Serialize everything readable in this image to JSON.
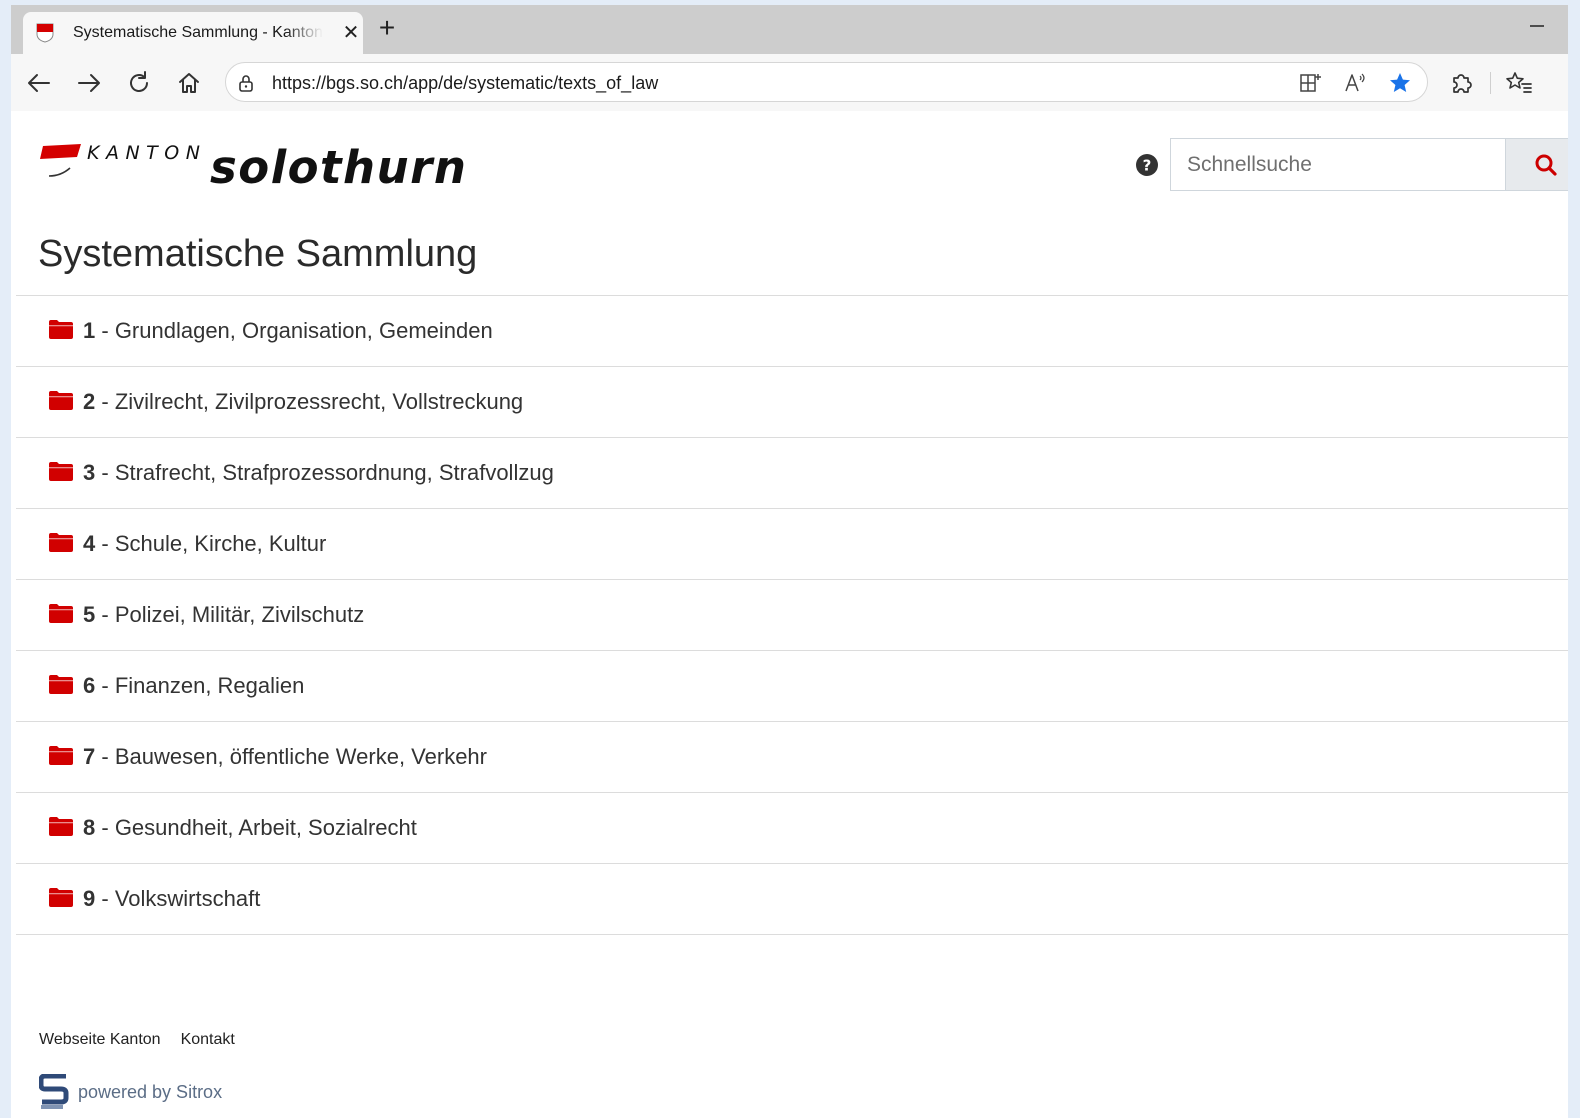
{
  "browser": {
    "tab": {
      "title": "Systematische Sammlung - Kanton Solothurn",
      "close_glyph": "✕"
    },
    "new_tab_glyph": "+",
    "url": "https://bgs.so.ch/app/de/systematic/texts_of_law",
    "favorite_color": "#1a73e8"
  },
  "header": {
    "logo": {
      "word1": "KANTON",
      "word2": "solothurn",
      "accent_color": "#d40000"
    },
    "search_placeholder": "Schnellsuche",
    "search_icon_color": "#cc0000"
  },
  "main": {
    "title": "Systematische Sammlung",
    "folder_color": "#d10000",
    "items": [
      {
        "number": "1",
        "separator": " - ",
        "label": "Grundlagen, Organisation, Gemeinden"
      },
      {
        "number": "2",
        "separator": " - ",
        "label": "Zivilrecht, Zivilprozessrecht, Vollstreckung"
      },
      {
        "number": "3",
        "separator": " - ",
        "label": "Strafrecht, Strafprozessordnung, Strafvollzug"
      },
      {
        "number": "4",
        "separator": " - ",
        "label": "Schule, Kirche, Kultur"
      },
      {
        "number": "5",
        "separator": " - ",
        "label": "Polizei, Militär, Zivilschutz"
      },
      {
        "number": "6",
        "separator": " - ",
        "label": "Finanzen, Regalien"
      },
      {
        "number": "7",
        "separator": " - ",
        "label": "Bauwesen, öffentliche Werke, Verkehr"
      },
      {
        "number": "8",
        "separator": " - ",
        "label": "Gesundheit, Arbeit, Sozialrecht"
      },
      {
        "number": "9",
        "separator": " - ",
        "label": "Volkswirtschaft"
      }
    ]
  },
  "footer": {
    "links": [
      "Webseite Kanton",
      "Kontakt"
    ],
    "powered_by": "powered by Sitrox",
    "powered_color": "#2f4a78"
  }
}
